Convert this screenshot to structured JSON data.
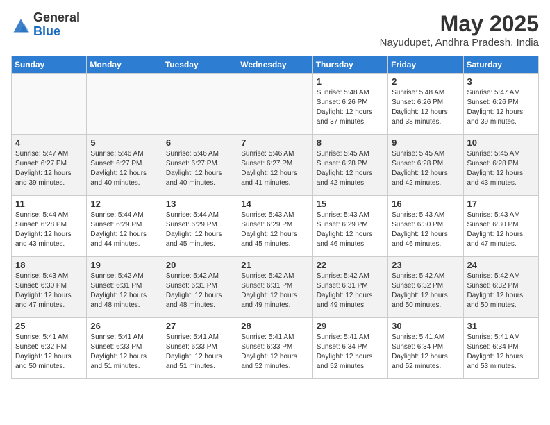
{
  "header": {
    "logo_general": "General",
    "logo_blue": "Blue",
    "month_title": "May 2025",
    "location": "Nayudupet, Andhra Pradesh, India"
  },
  "days_of_week": [
    "Sunday",
    "Monday",
    "Tuesday",
    "Wednesday",
    "Thursday",
    "Friday",
    "Saturday"
  ],
  "weeks": [
    [
      {
        "day": "",
        "info": ""
      },
      {
        "day": "",
        "info": ""
      },
      {
        "day": "",
        "info": ""
      },
      {
        "day": "",
        "info": ""
      },
      {
        "day": "1",
        "info": "Sunrise: 5:48 AM\nSunset: 6:26 PM\nDaylight: 12 hours\nand 37 minutes."
      },
      {
        "day": "2",
        "info": "Sunrise: 5:48 AM\nSunset: 6:26 PM\nDaylight: 12 hours\nand 38 minutes."
      },
      {
        "day": "3",
        "info": "Sunrise: 5:47 AM\nSunset: 6:26 PM\nDaylight: 12 hours\nand 39 minutes."
      }
    ],
    [
      {
        "day": "4",
        "info": "Sunrise: 5:47 AM\nSunset: 6:27 PM\nDaylight: 12 hours\nand 39 minutes."
      },
      {
        "day": "5",
        "info": "Sunrise: 5:46 AM\nSunset: 6:27 PM\nDaylight: 12 hours\nand 40 minutes."
      },
      {
        "day": "6",
        "info": "Sunrise: 5:46 AM\nSunset: 6:27 PM\nDaylight: 12 hours\nand 40 minutes."
      },
      {
        "day": "7",
        "info": "Sunrise: 5:46 AM\nSunset: 6:27 PM\nDaylight: 12 hours\nand 41 minutes."
      },
      {
        "day": "8",
        "info": "Sunrise: 5:45 AM\nSunset: 6:28 PM\nDaylight: 12 hours\nand 42 minutes."
      },
      {
        "day": "9",
        "info": "Sunrise: 5:45 AM\nSunset: 6:28 PM\nDaylight: 12 hours\nand 42 minutes."
      },
      {
        "day": "10",
        "info": "Sunrise: 5:45 AM\nSunset: 6:28 PM\nDaylight: 12 hours\nand 43 minutes."
      }
    ],
    [
      {
        "day": "11",
        "info": "Sunrise: 5:44 AM\nSunset: 6:28 PM\nDaylight: 12 hours\nand 43 minutes."
      },
      {
        "day": "12",
        "info": "Sunrise: 5:44 AM\nSunset: 6:29 PM\nDaylight: 12 hours\nand 44 minutes."
      },
      {
        "day": "13",
        "info": "Sunrise: 5:44 AM\nSunset: 6:29 PM\nDaylight: 12 hours\nand 45 minutes."
      },
      {
        "day": "14",
        "info": "Sunrise: 5:43 AM\nSunset: 6:29 PM\nDaylight: 12 hours\nand 45 minutes."
      },
      {
        "day": "15",
        "info": "Sunrise: 5:43 AM\nSunset: 6:29 PM\nDaylight: 12 hours\nand 46 minutes."
      },
      {
        "day": "16",
        "info": "Sunrise: 5:43 AM\nSunset: 6:30 PM\nDaylight: 12 hours\nand 46 minutes."
      },
      {
        "day": "17",
        "info": "Sunrise: 5:43 AM\nSunset: 6:30 PM\nDaylight: 12 hours\nand 47 minutes."
      }
    ],
    [
      {
        "day": "18",
        "info": "Sunrise: 5:43 AM\nSunset: 6:30 PM\nDaylight: 12 hours\nand 47 minutes."
      },
      {
        "day": "19",
        "info": "Sunrise: 5:42 AM\nSunset: 6:31 PM\nDaylight: 12 hours\nand 48 minutes."
      },
      {
        "day": "20",
        "info": "Sunrise: 5:42 AM\nSunset: 6:31 PM\nDaylight: 12 hours\nand 48 minutes."
      },
      {
        "day": "21",
        "info": "Sunrise: 5:42 AM\nSunset: 6:31 PM\nDaylight: 12 hours\nand 49 minutes."
      },
      {
        "day": "22",
        "info": "Sunrise: 5:42 AM\nSunset: 6:31 PM\nDaylight: 12 hours\nand 49 minutes."
      },
      {
        "day": "23",
        "info": "Sunrise: 5:42 AM\nSunset: 6:32 PM\nDaylight: 12 hours\nand 50 minutes."
      },
      {
        "day": "24",
        "info": "Sunrise: 5:42 AM\nSunset: 6:32 PM\nDaylight: 12 hours\nand 50 minutes."
      }
    ],
    [
      {
        "day": "25",
        "info": "Sunrise: 5:41 AM\nSunset: 6:32 PM\nDaylight: 12 hours\nand 50 minutes."
      },
      {
        "day": "26",
        "info": "Sunrise: 5:41 AM\nSunset: 6:33 PM\nDaylight: 12 hours\nand 51 minutes."
      },
      {
        "day": "27",
        "info": "Sunrise: 5:41 AM\nSunset: 6:33 PM\nDaylight: 12 hours\nand 51 minutes."
      },
      {
        "day": "28",
        "info": "Sunrise: 5:41 AM\nSunset: 6:33 PM\nDaylight: 12 hours\nand 52 minutes."
      },
      {
        "day": "29",
        "info": "Sunrise: 5:41 AM\nSunset: 6:34 PM\nDaylight: 12 hours\nand 52 minutes."
      },
      {
        "day": "30",
        "info": "Sunrise: 5:41 AM\nSunset: 6:34 PM\nDaylight: 12 hours\nand 52 minutes."
      },
      {
        "day": "31",
        "info": "Sunrise: 5:41 AM\nSunset: 6:34 PM\nDaylight: 12 hours\nand 53 minutes."
      }
    ]
  ]
}
